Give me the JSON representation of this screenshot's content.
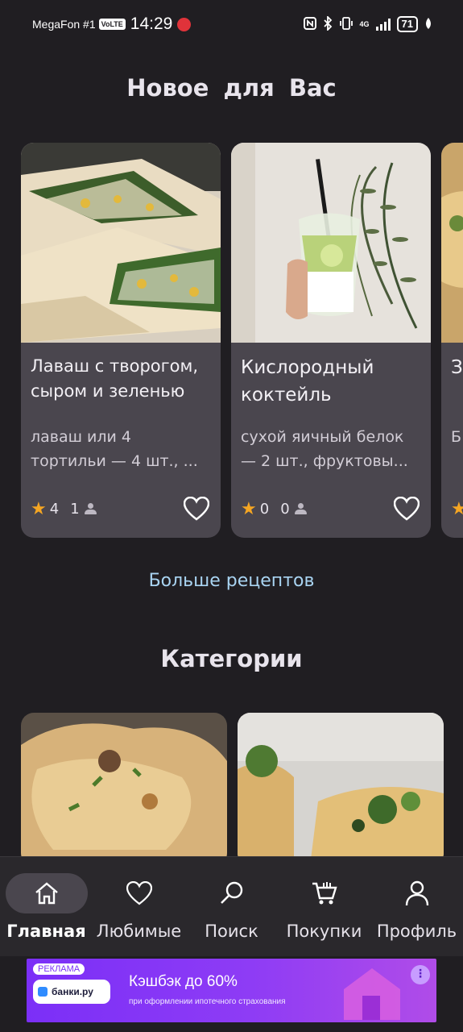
{
  "status_bar": {
    "carrier": "MegaFon #1",
    "volte": "VoLTE",
    "time": "14:29",
    "network": "4G",
    "battery": "71"
  },
  "new_section": {
    "title": "Новое для Вас"
  },
  "recipes": [
    {
      "title": "Лаваш с творогом, сыром и зеленью",
      "description": "лаваш или 4 тортильи — 4 шт., ...",
      "rating": "4",
      "reviews": "1"
    },
    {
      "title": "Кислородный коктейль",
      "description": "сухой яичный белок — 2 шт., фруктовы...",
      "rating": "0",
      "reviews": "0"
    },
    {
      "title": "З б",
      "description": "Б Л"
    }
  ],
  "more_link": "Больше рецептов",
  "categories_section": {
    "title": "Категории"
  },
  "bottom_nav": [
    {
      "label": "Главная",
      "icon": "home-icon",
      "active": true
    },
    {
      "label": "Любимые",
      "icon": "heart-icon",
      "active": false
    },
    {
      "label": "Поиск",
      "icon": "search-icon",
      "active": false
    },
    {
      "label": "Покупки",
      "icon": "cart-icon",
      "active": false
    },
    {
      "label": "Профиль",
      "icon": "user-icon",
      "active": false
    }
  ],
  "ad": {
    "tag": "РЕКЛАМА",
    "brand": "банки.ру",
    "headline": "Кэшбэк до 60%",
    "subtext": "при оформлении ипотечного страхования"
  },
  "colors": {
    "background": "#201e22",
    "card": "#4a464e",
    "link": "#a9d4f2",
    "star": "#f5a623",
    "ad_purple": "#7b2ff7"
  }
}
